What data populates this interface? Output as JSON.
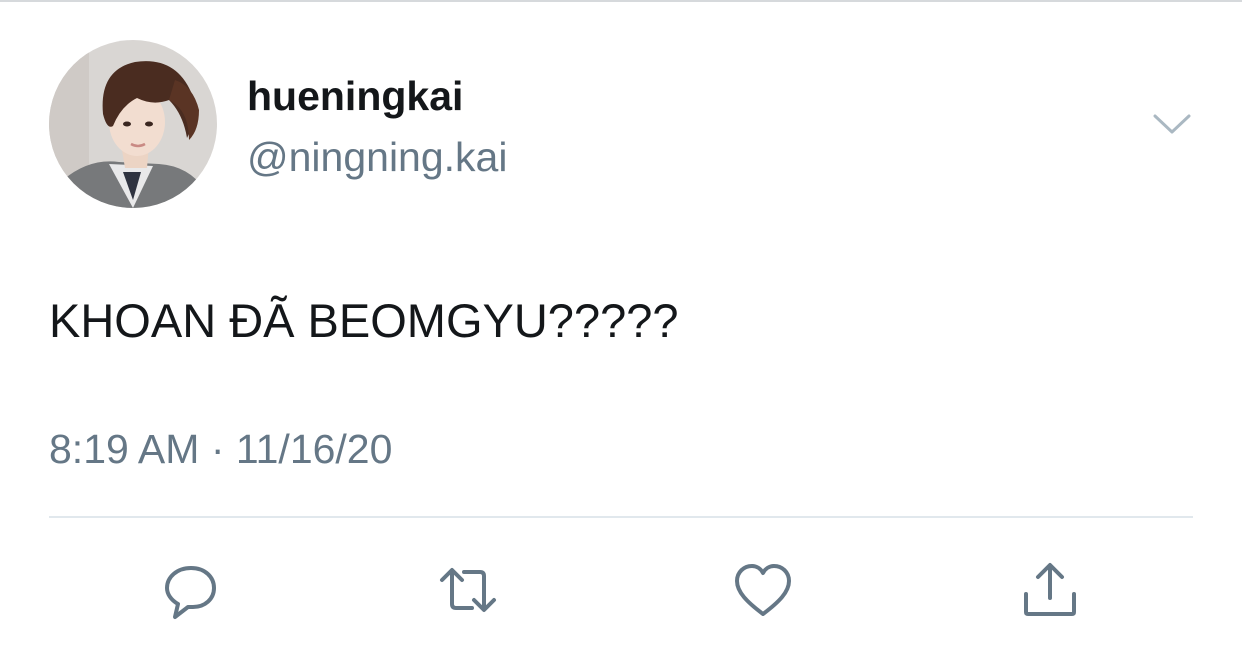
{
  "tweet": {
    "author": {
      "display_name": "hueningkai",
      "handle": "@ningning.kai"
    },
    "text": "KHOAN ĐÃ BEOMGYU?????",
    "timestamp": "8:19 AM · 11/16/20"
  },
  "actions": [
    {
      "name": "reply",
      "icon": "comment-bubble-icon"
    },
    {
      "name": "retweet",
      "icon": "retweet-arrows-icon"
    },
    {
      "name": "like",
      "icon": "heart-icon"
    },
    {
      "name": "share",
      "icon": "share-upload-icon"
    }
  ],
  "colors": {
    "text_primary": "#14171a",
    "text_secondary": "#657786",
    "icon": "#657786",
    "divider": "#e1e8ed"
  }
}
